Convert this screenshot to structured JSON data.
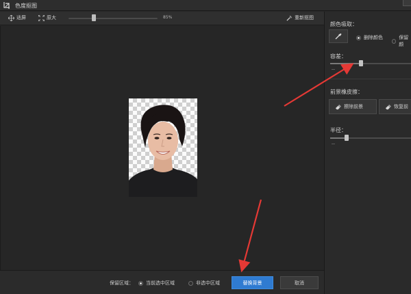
{
  "titlebar": {
    "title": "色度抠图"
  },
  "toolbar": {
    "fit_label": "适屏",
    "original_label": "原大",
    "zoom_value": 85,
    "zoom_text": "85%",
    "redo_label": "重新抠图"
  },
  "panel": {
    "color_pick_title": "颜色吸取：",
    "remove_color_label": "删除颜色",
    "keep_color_label": "保留颜",
    "tolerance_title": "容差：",
    "tolerance_value": 0.4,
    "fg_eraser_title": "前景橡皮擦：",
    "erase_fg_label": "擦除前景",
    "restore_fg_label": "恢复前",
    "radius_title": "半径：",
    "radius_value": 0.2
  },
  "bottom": {
    "keep_area_label": "保留区域：",
    "current_area_label": "当前选中区域",
    "non_area_label": "非选中区域",
    "replace_bg_label": "替换背景",
    "cancel_label": "取消"
  },
  "colors": {
    "accent": "#2f7bd1",
    "annotation": "#e53935"
  },
  "icons": [
    "crop-icon",
    "fit-screen-icon",
    "original-size-icon",
    "redo-cutout-icon",
    "eyedropper-icon",
    "eraser-icon"
  ]
}
